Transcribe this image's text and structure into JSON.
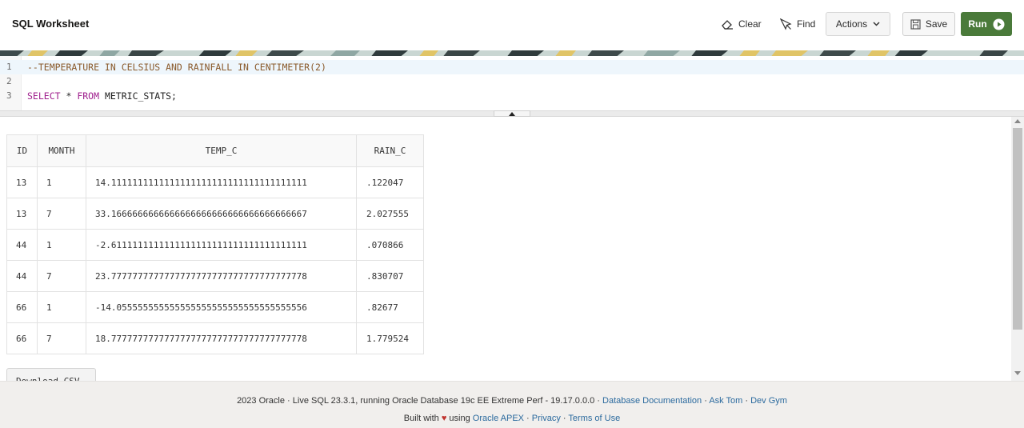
{
  "header": {
    "title": "SQL Worksheet",
    "clear_label": "Clear",
    "find_label": "Find",
    "actions_label": "Actions",
    "save_label": "Save",
    "run_label": "Run",
    "run_color": "#4a7a3a"
  },
  "editor": {
    "lines": [
      {
        "number": "1",
        "comment": "--TEMPERATURE IN CELSIUS AND RAINFALL IN CENTIMETER(2)"
      },
      {
        "number": "2"
      },
      {
        "number": "3",
        "kw_select": "SELECT",
        "star": " * ",
        "kw_from": "FROM",
        "table": " METRIC_STATS;"
      }
    ]
  },
  "results": {
    "columns": [
      "ID",
      "MONTH",
      "TEMP_C",
      "RAIN_C"
    ],
    "rows": [
      [
        "13",
        "1",
        "14.1111111111111111111111111111111111111",
        ".122047"
      ],
      [
        "13",
        "7",
        "33.1666666666666666666666666666666666667",
        "2.027555"
      ],
      [
        "44",
        "1",
        "-2.6111111111111111111111111111111111111",
        ".070866"
      ],
      [
        "44",
        "7",
        "23.7777777777777777777777777777777777778",
        ".830707"
      ],
      [
        "66",
        "1",
        "-14.055555555555555555555555555555555556",
        ".82677"
      ],
      [
        "66",
        "7",
        "18.7777777777777777777777777777777777778",
        "1.779524"
      ]
    ],
    "download_label": "Download CSV"
  },
  "footer": {
    "line1_text": "2023 Oracle · Live SQL 23.3.1, running Oracle Database 19c EE Extreme Perf - 19.17.0.0.0 · ",
    "doc_link": "Database Documentation",
    "sep1": " · ",
    "ask_tom": "Ask Tom",
    "sep2": " · ",
    "dev_gym": "Dev Gym",
    "built_with": "Built with ",
    "heart": "♥",
    "using": " using ",
    "apex_link": "Oracle APEX",
    "sep3": " · ",
    "privacy": "Privacy",
    "sep4": " · ",
    "terms": "Terms of Use"
  }
}
